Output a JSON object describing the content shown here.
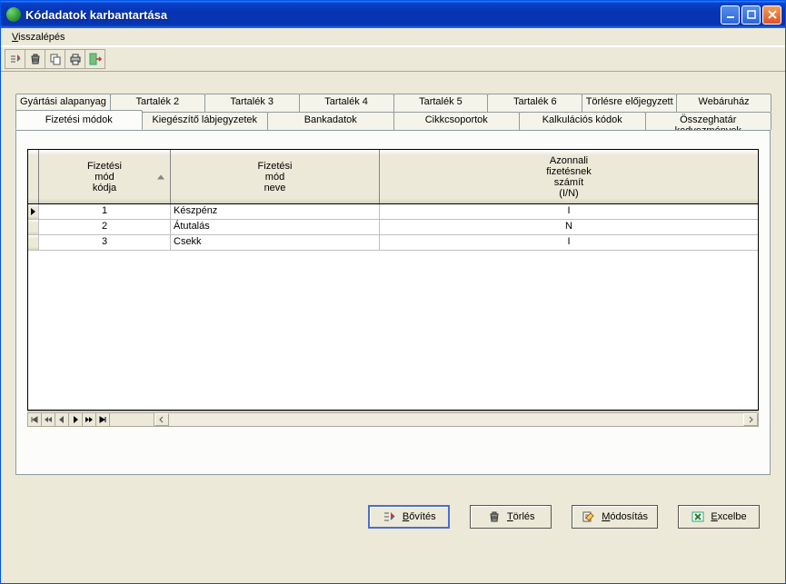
{
  "window": {
    "title": "Kódadatok karbantartása"
  },
  "menu": {
    "visszalepes_html": "<u>V</u>isszalépés"
  },
  "toolbar_icons": [
    "add-record",
    "delete-record",
    "copy-record",
    "print",
    "exit"
  ],
  "tabs_row1": [
    {
      "label": "Gyártási alapanyag"
    },
    {
      "label": "Tartalék 2"
    },
    {
      "label": "Tartalék 3"
    },
    {
      "label": "Tartalék 4"
    },
    {
      "label": "Tartalék 5"
    },
    {
      "label": "Tartalék 6"
    },
    {
      "label": "Törlésre előjegyzett"
    },
    {
      "label": "Webáruház"
    }
  ],
  "tabs_row2": [
    {
      "label": "Fizetési módok",
      "active": true
    },
    {
      "label": "Kiegészítő lábjegyzetek"
    },
    {
      "label": "Bankadatok"
    },
    {
      "label": "Cikkcsoportok"
    },
    {
      "label": "Kalkulációs kódok"
    },
    {
      "label": "Összeghatár kedvezmények"
    }
  ],
  "grid": {
    "headers": {
      "c1": "Fizetési\nmód\nkódja",
      "c2": "Fizetési\nmód\nneve",
      "c3": "Azonnali\nfizetésnek\nszámít\n(I/N)"
    },
    "rows": [
      {
        "current": true,
        "code": "1",
        "name": "Készpénz",
        "instant": "I"
      },
      {
        "current": false,
        "code": "2",
        "name": "Átutalás",
        "instant": "N"
      },
      {
        "current": false,
        "code": "3",
        "name": "Csekk",
        "instant": "I"
      }
    ]
  },
  "buttons": {
    "bovites_html": "<u>B</u>ővítés",
    "torles_html": "<u>T</u>örlés",
    "modositas_html": "<u>M</u>ódosítás",
    "excelbe_html": "<u>E</u>xcelbe"
  }
}
